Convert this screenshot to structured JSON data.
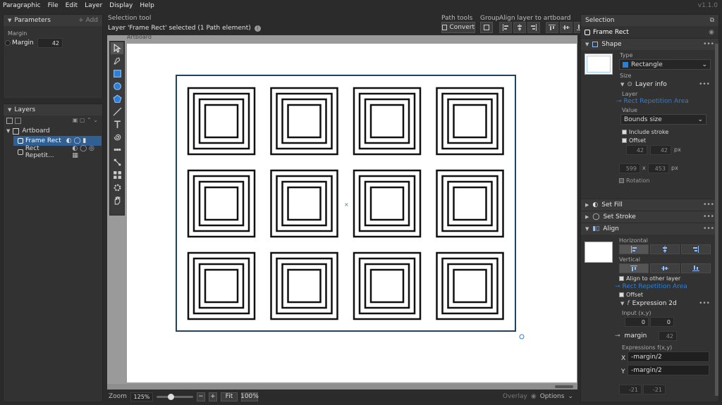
{
  "menu": {
    "app": "Paragraphic",
    "items": [
      "File",
      "Edit",
      "Layer",
      "Display",
      "Help"
    ],
    "version": "v1.1.0"
  },
  "params": {
    "title": "Parameters",
    "add": "+ Add",
    "section": "Margin",
    "name": "Margin",
    "value": "42"
  },
  "layers": {
    "title": "Layers",
    "root": "Artboard",
    "items": [
      "Frame Rect",
      "Rect Repetit..."
    ]
  },
  "toolbar": {
    "tool_name": "Selection tool",
    "status": "Layer 'Frame Rect' selected (1 Path element)",
    "path_tools": "Path tools",
    "convert": "Convert",
    "group": "Group",
    "align_label": "Align layer to artboard"
  },
  "canvas": {
    "artboard_label": "Artboard"
  },
  "bottom": {
    "zoom_label": "Zoom",
    "zoom": "125%",
    "fit": "Fit",
    "full": "100%",
    "overlay": "Overlay",
    "options": "Options"
  },
  "selection": {
    "title": "Selection",
    "layer_name": "Frame Rect",
    "shape": {
      "title": "Shape",
      "type_label": "Type",
      "type": "Rectangle",
      "size_label": "Size",
      "layer_info": "Layer info",
      "layer_label": "Layer",
      "layer_ref": "Rect Repetition Area",
      "value_label": "Value",
      "value": "Bounds size",
      "include_stroke": "Include stroke",
      "offset": "Offset",
      "off_x": "42",
      "off_y": "42",
      "px1": "px",
      "w": "599",
      "x_sep": "x",
      "h": "453",
      "px2": "px",
      "rotation": "Rotation"
    },
    "fill": "Set Fill",
    "stroke": "Set Stroke",
    "align": {
      "title": "Align",
      "horizontal": "Horizontal",
      "vertical": "Vertical",
      "other": "Align to other layer",
      "other_ref": "Rect Repetition Area",
      "offset": "Offset",
      "expr": "Expression 2d",
      "input_label": "Input (x,y)",
      "in_x": "0",
      "in_y": "0",
      "margin": "margin",
      "margin_val": "42",
      "exprs_label": "Expressions f(x,y)",
      "x_lbl": "X",
      "x_expr": "-margin/2",
      "y_lbl": "Y",
      "y_expr": "-margin/2",
      "out_x": "-21",
      "out_y": "-21"
    }
  },
  "colors": {
    "accent": "#2d7fd6",
    "panel": "#323232",
    "canvas_bg": "#9a9a9a"
  }
}
